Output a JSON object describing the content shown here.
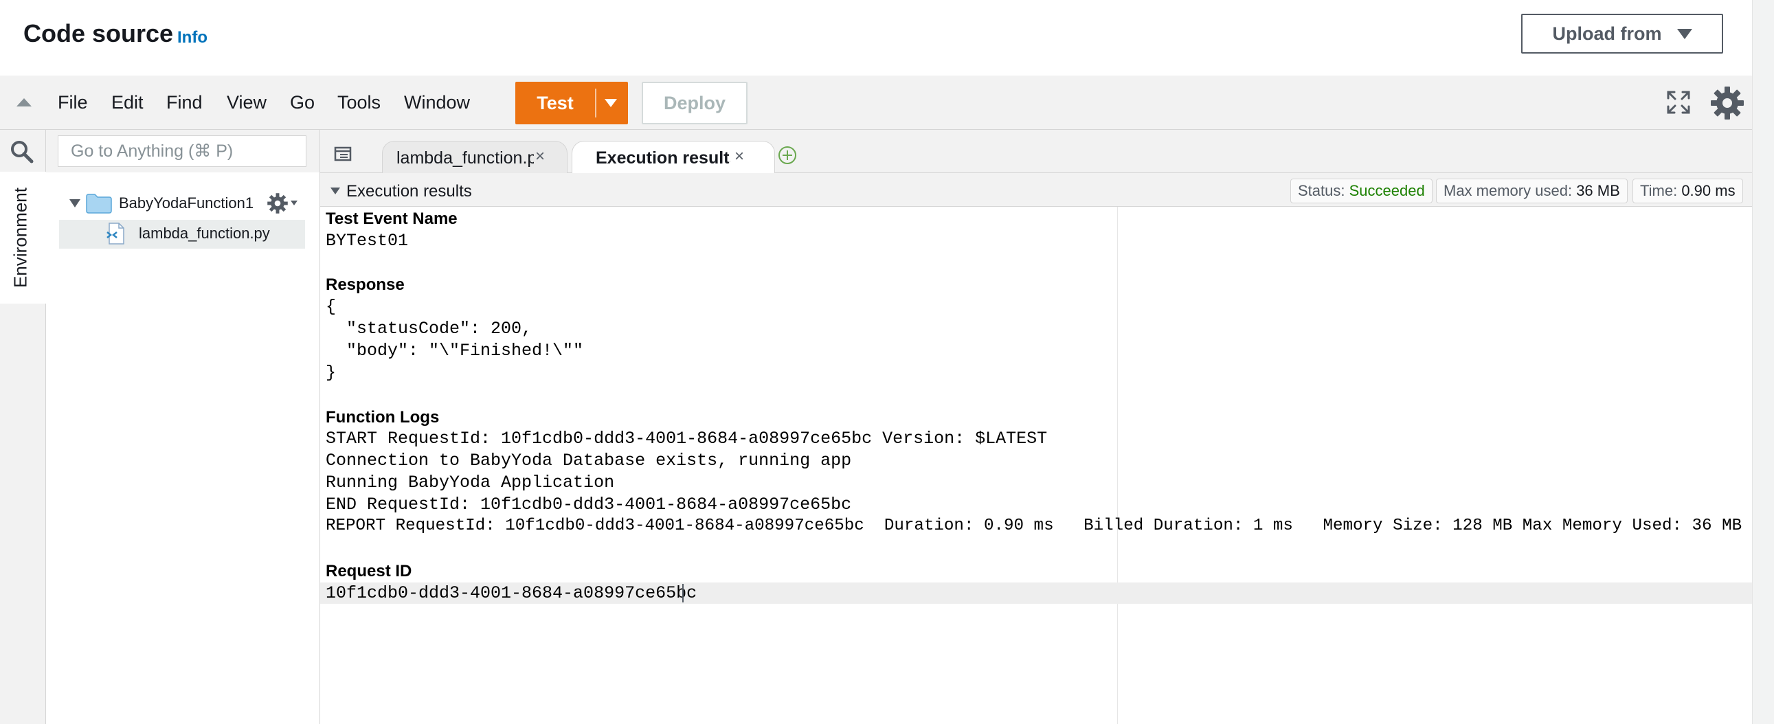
{
  "header": {
    "title": "Code source",
    "info_link": "Info",
    "upload_button": "Upload from"
  },
  "menu": {
    "items": [
      "File",
      "Edit",
      "Find",
      "View",
      "Go",
      "Tools",
      "Window"
    ],
    "test_button": "Test",
    "deploy_button": "Deploy"
  },
  "sidebar": {
    "environment_tab": "Environment",
    "search_placeholder": "Go to Anything (⌘ P)",
    "folder_name": "BabyYodaFunction1",
    "file_name": "lambda_function.py"
  },
  "tabs": {
    "items": [
      {
        "label": "lambda_function.py",
        "close": "×"
      },
      {
        "label": "Execution results",
        "close": "×"
      }
    ]
  },
  "results": {
    "title": "Execution results",
    "status_label": "Status:",
    "status_value": "Succeeded",
    "memory_label": "Max memory used:",
    "memory_value": "36 MB",
    "time_label": "Time:",
    "time_value": "0.90 ms",
    "test_event_label": "Test Event Name",
    "test_event_value": "BYTest01",
    "response_label": "Response",
    "response_lines": [
      "{",
      "  \"statusCode\": 200,",
      "  \"body\": \"\\\"Finished!\\\"\"",
      "}"
    ],
    "logs_label": "Function Logs",
    "log_lines": [
      "START RequestId: 10f1cdb0-ddd3-4001-8684-a08997ce65bc Version: $LATEST",
      "Connection to BabyYoda Database exists, running app",
      "Running BabyYoda Application",
      "END RequestId: 10f1cdb0-ddd3-4001-8684-a08997ce65bc",
      "REPORT RequestId: 10f1cdb0-ddd3-4001-8684-a08997ce65bc  Duration: 0.90 ms   Billed Duration: 1 ms   Memory Size: 128 MB Max Memory Used: 36 MB"
    ],
    "request_id_label": "Request ID",
    "request_id_value": "10f1cdb0-ddd3-4001-8684-a08997ce65bc"
  },
  "colors": {
    "accent": "#ec7211",
    "link": "#0073bb",
    "success": "#1d8102"
  },
  "icons": [
    "search-icon",
    "expand-icon",
    "settings-icon",
    "folder-icon",
    "python-file-icon",
    "gear-icon",
    "tab-list-icon",
    "add-tab-icon"
  ]
}
